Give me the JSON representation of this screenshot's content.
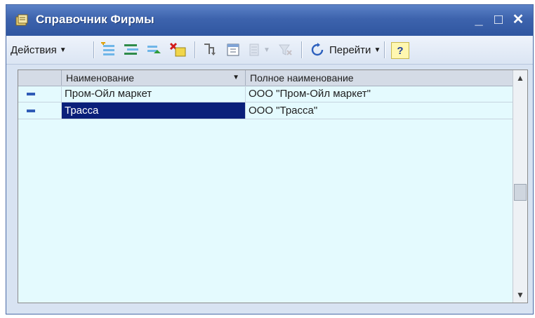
{
  "window": {
    "title": "Справочник Фирмы",
    "controls": {
      "minimize": "_",
      "maximize": "□",
      "close": "✕"
    }
  },
  "toolbar": {
    "actions_label": "Действия",
    "goto_label": "Перейти",
    "help_label": "?",
    "icons": [
      "add-icon",
      "add-group-icon",
      "copy-icon",
      "delete-icon",
      "hierarchy-icon",
      "select-level-icon",
      "filter-icon",
      "clear-filter-icon",
      "refresh-icon",
      "help-icon"
    ]
  },
  "grid": {
    "columns": [
      {
        "label": ""
      },
      {
        "label": "Наименование"
      },
      {
        "label": "Полное наименование"
      }
    ],
    "rows": [
      {
        "name": "Пром-Ойл маркет",
        "full_name": "ООО \"Пром-Ойл маркет\""
      },
      {
        "name": "Трасса",
        "full_name": "ООО \"Трасса\""
      }
    ]
  },
  "colors": {
    "title_bar": "#3d63ad",
    "row_background": "#e4fafe",
    "selected_cell": "#0a1f7a",
    "row_marker": "#2f5bb7"
  }
}
